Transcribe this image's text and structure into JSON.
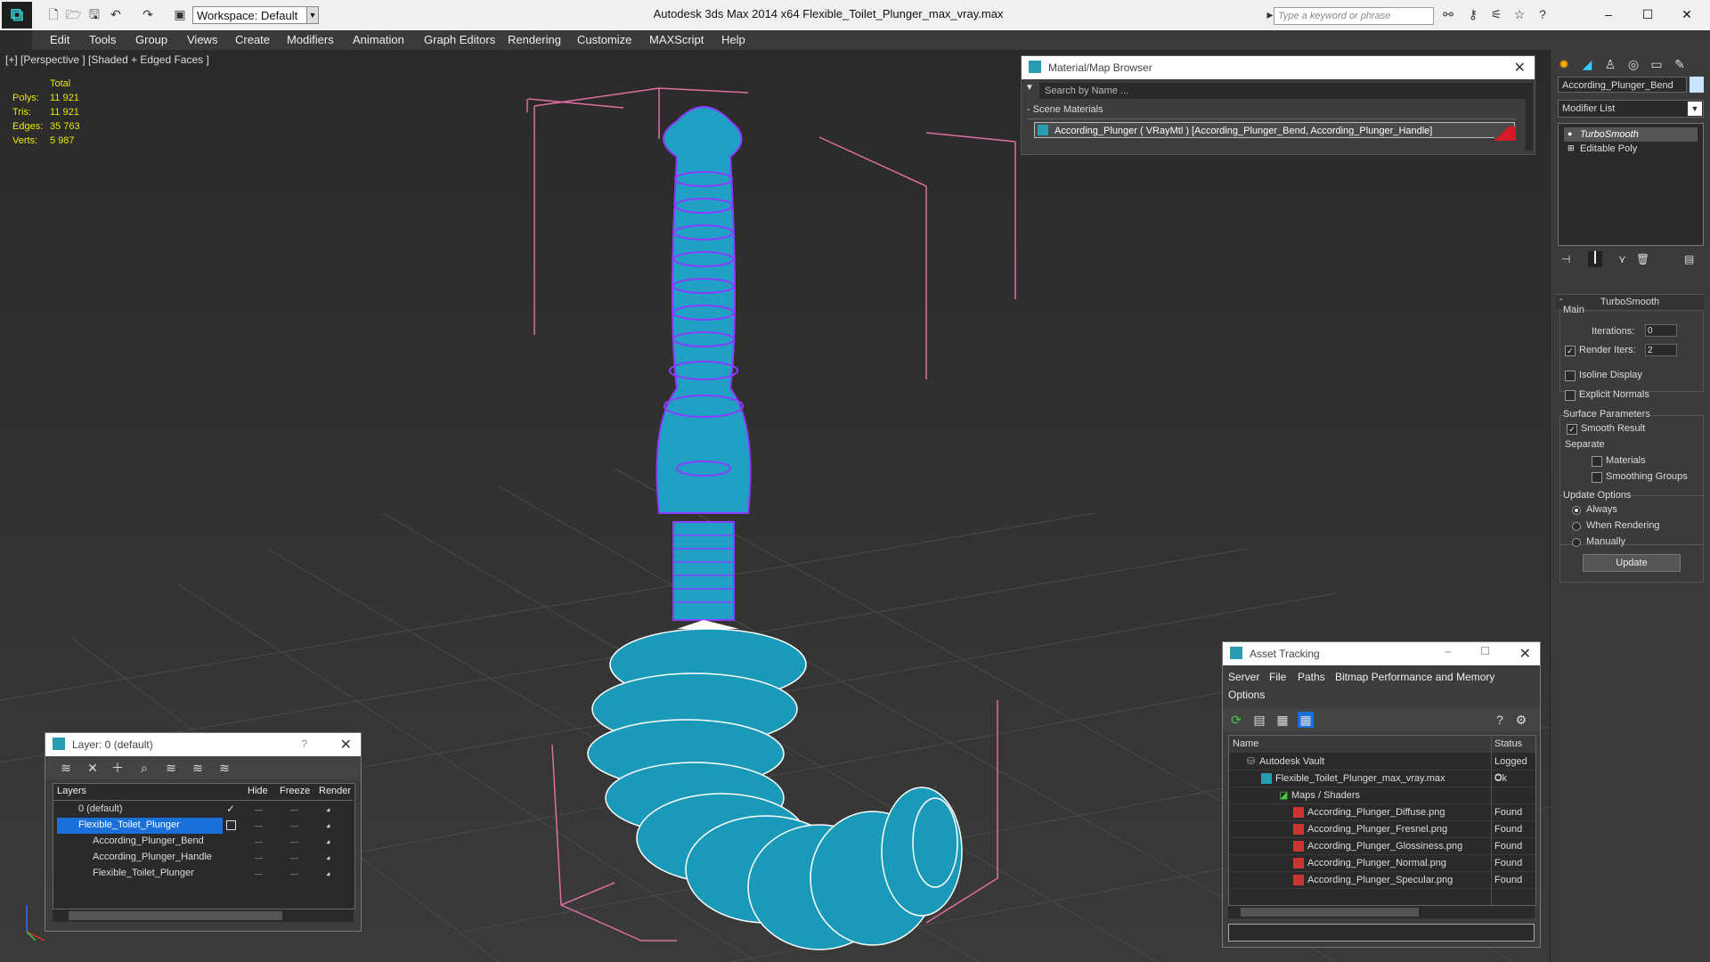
{
  "app": {
    "title": "Autodesk 3ds Max  2014 x64      Flexible_Toilet_Plunger_max_vray.max",
    "workspace": "Workspace: Default",
    "search_placeholder": "Type a keyword or phrase"
  },
  "menu": [
    "Edit",
    "Tools",
    "Group",
    "Views",
    "Create",
    "Modifiers",
    "Animation",
    "Graph Editors",
    "Rendering",
    "Customize",
    "MAXScript",
    "Help"
  ],
  "viewport": {
    "label": "[+] [Perspective ] [Shaded + Edged Faces ]",
    "stats_header": "Total",
    "stats": [
      {
        "label": "Polys:",
        "value": "11 921"
      },
      {
        "label": "Tris:",
        "value": "11 921"
      },
      {
        "label": "Edges:",
        "value": "35 763"
      },
      {
        "label": "Verts:",
        "value": "5 987"
      }
    ]
  },
  "material_browser": {
    "title": "Material/Map Browser",
    "search": "Search by Name ...",
    "section": "- Scene Materials",
    "item": "According_Plunger  ( VRayMtl ) [According_Plunger_Bend, According_Plunger_Handle]"
  },
  "command_panel": {
    "object_name": "According_Plunger_Bend",
    "modifier_list": "Modifier List",
    "stack": [
      "TurboSmooth",
      "Editable Poly"
    ],
    "rollout": "TurboSmooth",
    "main": "Main",
    "iterations_label": "Iterations:",
    "iterations": "0",
    "render_iters_label": "Render Iters:",
    "render_iters": "2",
    "isoline": "Isoline Display",
    "explicit_normals": "Explicit Normals",
    "surface_params": "Surface Parameters",
    "smooth_result": "Smooth Result",
    "separate": "Separate",
    "materials": "Materials",
    "smoothing_groups": "Smoothing Groups",
    "update_options": "Update Options",
    "always": "Always",
    "when_rendering": "When Rendering",
    "manually": "Manually",
    "update": "Update"
  },
  "layer_window": {
    "title": "Layer: 0 (default)",
    "help": "?",
    "headers": {
      "layers": "Layers",
      "hide": "Hide",
      "freeze": "Freeze",
      "render": "Render"
    },
    "rows": [
      "0 (default)",
      "Flexible_Toilet_Plunger",
      "According_Plunger_Bend",
      "According_Plunger_Handle",
      "Flexible_Toilet_Plunger"
    ]
  },
  "asset_tracking": {
    "title": "Asset Tracking",
    "menu": [
      "Server",
      "File",
      "Paths",
      "Bitmap Performance and Memory",
      "Options"
    ],
    "headers": {
      "name": "Name",
      "status": "Status"
    },
    "rows": [
      {
        "name": "Autodesk Vault",
        "status": "Logged O"
      },
      {
        "name": "Flexible_Toilet_Plunger_max_vray.max",
        "status": "Ok"
      },
      {
        "name": "Maps / Shaders",
        "status": ""
      },
      {
        "name": "According_Plunger_Diffuse.png",
        "status": "Found"
      },
      {
        "name": "According_Plunger_Fresnel.png",
        "status": "Found"
      },
      {
        "name": "According_Plunger_Glossiness.png",
        "status": "Found"
      },
      {
        "name": "According_Plunger_Normal.png",
        "status": "Found"
      },
      {
        "name": "According_Plunger_Specular.png",
        "status": "Found"
      }
    ]
  }
}
